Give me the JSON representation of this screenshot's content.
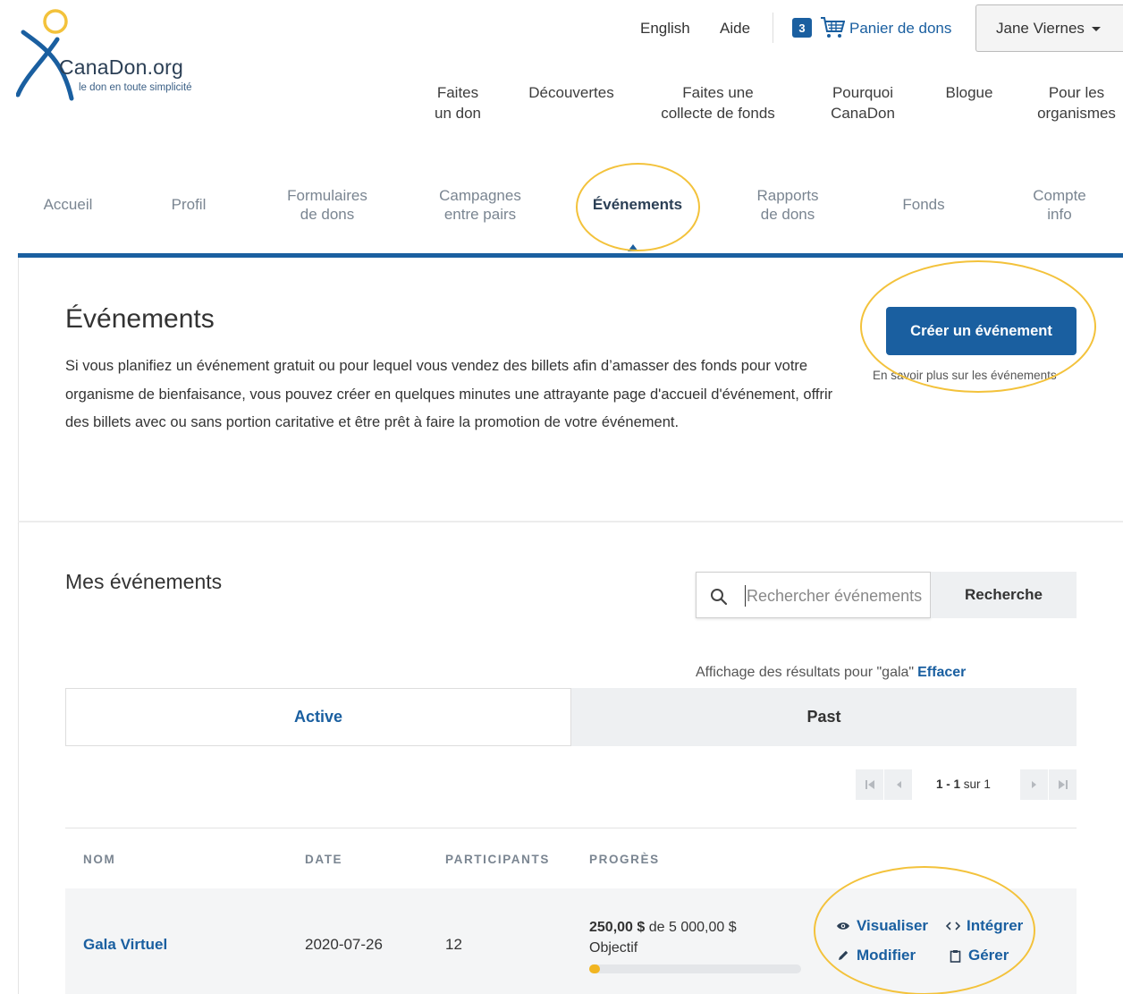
{
  "brand": {
    "name": "CanaDon.org",
    "tagline": "le don en toute simplicité"
  },
  "header": {
    "language_link": "English",
    "help_link": "Aide",
    "cart_count": "3",
    "cart_label": "Panier de dons",
    "user_name": "Jane Viernes"
  },
  "main_nav": [
    {
      "label": "Faites\nun don"
    },
    {
      "label": "Découvertes"
    },
    {
      "label": "Faites une\ncollecte de fonds"
    },
    {
      "label": "Pourquoi\nCanaDon"
    },
    {
      "label": "Blogue"
    },
    {
      "label": "Pour les\norganismes"
    }
  ],
  "sub_nav": [
    {
      "label": "Accueil"
    },
    {
      "label": "Profil"
    },
    {
      "label": "Formulaires\nde dons"
    },
    {
      "label": "Campagnes\nentre pairs"
    },
    {
      "label": "Événements",
      "active": true
    },
    {
      "label": "Rapports\nde dons"
    },
    {
      "label": "Fonds"
    },
    {
      "label": "Compte\ninfo"
    }
  ],
  "events": {
    "title": "Événements",
    "description": "Si vous planifiez un événement gratuit ou pour lequel vous vendez des billets afin d’amasser des fonds pour votre organisme de bienfaisance, vous pouvez créer en quelques minutes une attrayante page d'accueil d'événement, offrir des billets avec ou sans portion caritative et être prêt à faire la promotion de votre événement.",
    "create_button": "Créer un événement",
    "learn_more": "En savoir plus sur les événements"
  },
  "my_events": {
    "title": "Mes événements",
    "search_placeholder": "Rechercher événements",
    "search_button": "Recherche",
    "results_prefix": "Affichage des résultats pour \"gala\"",
    "clear_link": "Effacer",
    "tabs": {
      "active": "Active",
      "past": "Past"
    },
    "pagination": {
      "range": "1 - 1",
      "of_label": "sur",
      "total": "1"
    },
    "columns": {
      "name": "NOM",
      "date": "DATE",
      "participants": "PARTICIPANTS",
      "progress": "PROGRÈS"
    },
    "rows": [
      {
        "name": "Gala Virtuel",
        "date": "2020-07-26",
        "participants": "12",
        "raised": "250,00 $",
        "of_label": "de",
        "goal": "5 000,00 $",
        "goal_label": "Objectif",
        "progress_fraction": 0.05,
        "actions": {
          "view": "Visualiser",
          "embed": "Intégrer",
          "edit": "Modifier",
          "manage": "Gérer"
        }
      }
    ]
  },
  "colors": {
    "primary": "#1a5fa0",
    "highlight": "#f3c23b",
    "progress": "#f1b521"
  }
}
